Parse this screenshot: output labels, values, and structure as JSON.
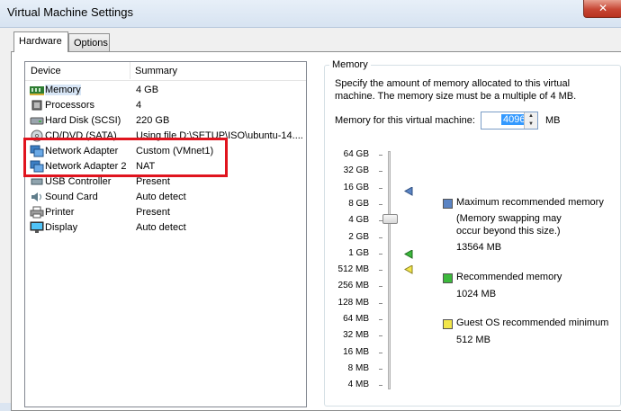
{
  "window": {
    "title": "Virtual Machine Settings",
    "close_glyph": "✕"
  },
  "tabs": [
    {
      "label": "Hardware"
    },
    {
      "label": "Options"
    }
  ],
  "devices": {
    "header": {
      "device": "Device",
      "summary": "Summary"
    },
    "rows": [
      {
        "name": "Memory",
        "summary": "4 GB",
        "icon": "memory-icon"
      },
      {
        "name": "Processors",
        "summary": "4",
        "icon": "processor-icon"
      },
      {
        "name": "Hard Disk (SCSI)",
        "summary": "220 GB",
        "icon": "harddisk-icon"
      },
      {
        "name": "CD/DVD (SATA)",
        "summary": "Using file D:\\SETUP\\ISO\\ubuntu-14....",
        "icon": "cd-icon"
      },
      {
        "name": "Network Adapter",
        "summary": "Custom (VMnet1)",
        "icon": "network-icon"
      },
      {
        "name": "Network Adapter 2",
        "summary": "NAT",
        "icon": "network-icon"
      },
      {
        "name": "USB Controller",
        "summary": "Present",
        "icon": "usb-icon"
      },
      {
        "name": "Sound Card",
        "summary": "Auto detect",
        "icon": "sound-icon"
      },
      {
        "name": "Printer",
        "summary": "Present",
        "icon": "printer-icon"
      },
      {
        "name": "Display",
        "summary": "Auto detect",
        "icon": "display-icon"
      }
    ]
  },
  "memory": {
    "group_title": "Memory",
    "description": "Specify the amount of memory allocated to this virtual machine. The memory size must be a multiple of 4 MB.",
    "field_label": "Memory for this virtual machine:",
    "value": "4096",
    "unit": "MB",
    "scale": [
      "64 GB",
      "32 GB",
      "16 GB",
      "8 GB",
      "4 GB",
      "2 GB",
      "1 GB",
      "512 MB",
      "256 MB",
      "128 MB",
      "64 MB",
      "32 MB",
      "16 MB",
      "8 MB",
      "4 MB"
    ],
    "legend": {
      "max_label": "Maximum recommended memory",
      "max_note_1": "(Memory swapping may",
      "max_note_2": "occur beyond this size.)",
      "max_value": "13564 MB",
      "rec_label": "Recommended memory",
      "rec_value": "1024 MB",
      "guest_label": "Guest OS recommended minimum",
      "guest_value": "512 MB"
    },
    "colors": {
      "max": "#5b84c4",
      "recommended": "#3cb93c",
      "guest_min": "#f2e64a"
    }
  },
  "annotation": {
    "color": "#e0141e"
  }
}
